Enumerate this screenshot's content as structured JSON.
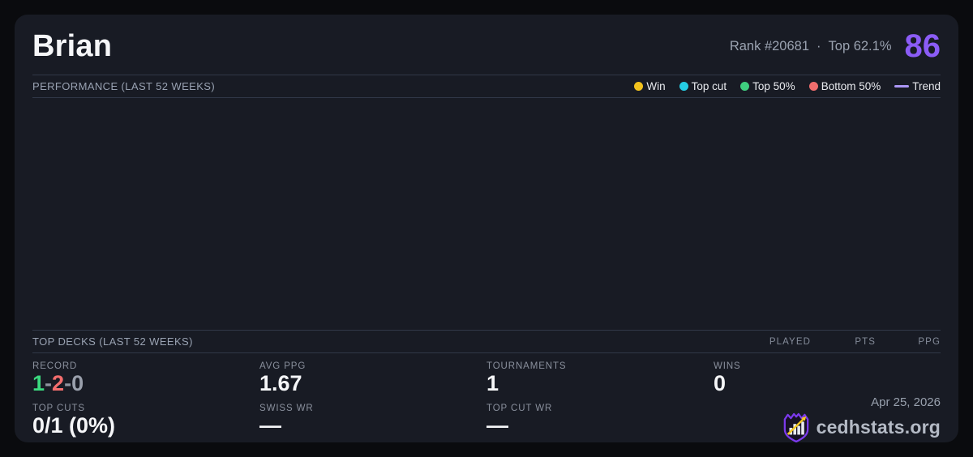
{
  "colors": {
    "page_bg": "#0a0b0e",
    "card_bg": "#181b24",
    "divider": "#313848",
    "accent_purple": "#8b5cf6",
    "win_yellow": "#f2c21d",
    "topcut_cyan": "#25cde4",
    "top50_green": "#3fcf7f",
    "bottom50_red": "#f06d6d",
    "trend_purple": "#ab96f5",
    "value_green": "#3bd97f",
    "value_red": "#f46e6e"
  },
  "header": {
    "title": "Brian",
    "rank": "Rank #20681",
    "separator": "·",
    "top_percent": "Top 62.1%",
    "score": "86"
  },
  "performance": {
    "label": "PERFORMANCE (LAST 52 WEEKS)",
    "legend": [
      {
        "label": "Win",
        "color": "#f2c21d",
        "type": "dot"
      },
      {
        "label": "Top cut",
        "color": "#25cde4",
        "type": "dot"
      },
      {
        "label": "Top 50%",
        "color": "#3fcf7f",
        "type": "dot"
      },
      {
        "label": "Bottom 50%",
        "color": "#f06d6d",
        "type": "dot"
      },
      {
        "label": "Trend",
        "color": "#ab96f5",
        "type": "line"
      }
    ],
    "chart_points": []
  },
  "top_decks": {
    "label": "TOP DECKS (LAST 52 WEEKS)",
    "columns": [
      "PLAYED",
      "PTS",
      "PPG"
    ],
    "rows": []
  },
  "stats": {
    "record": {
      "label": "RECORD",
      "parts": [
        {
          "text": "1",
          "cls": "c-green"
        },
        {
          "text": "-",
          "cls": "c-dim"
        },
        {
          "text": "2",
          "cls": "c-red"
        },
        {
          "text": "-",
          "cls": "c-dim"
        },
        {
          "text": "0",
          "cls": "c-gray"
        }
      ]
    },
    "avg_ppg": {
      "label": "AVG PPG",
      "value": "1.67"
    },
    "tournaments": {
      "label": "TOURNAMENTS",
      "value": "1"
    },
    "wins": {
      "label": "WINS",
      "value": "0"
    },
    "top_cuts": {
      "label": "TOP CUTS",
      "value": "0/1 (0%)"
    },
    "swiss_wr": {
      "label": "SWISS WR",
      "value": "—"
    },
    "top_cut_wr": {
      "label": "TOP CUT WR",
      "value": "—"
    }
  },
  "footer": {
    "date": "Apr 25, 2026",
    "brand": "cedhstats.org"
  }
}
